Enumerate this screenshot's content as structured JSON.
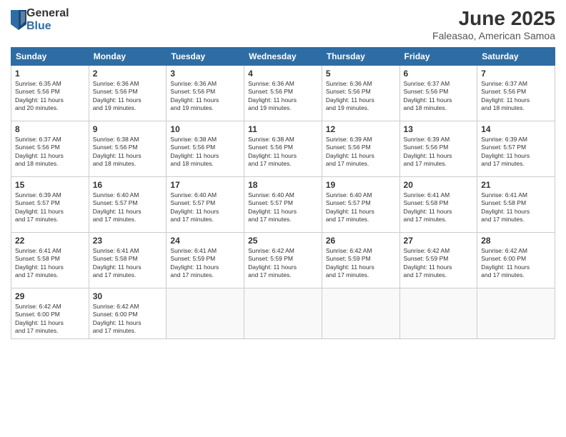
{
  "logo": {
    "general": "General",
    "blue": "Blue"
  },
  "title": "June 2025",
  "location": "Faleasao, American Samoa",
  "headers": [
    "Sunday",
    "Monday",
    "Tuesday",
    "Wednesday",
    "Thursday",
    "Friday",
    "Saturday"
  ],
  "weeks": [
    [
      {
        "day": "1",
        "sunrise": "6:35 AM",
        "sunset": "5:56 PM",
        "daylight": "11 hours and 20 minutes."
      },
      {
        "day": "2",
        "sunrise": "6:36 AM",
        "sunset": "5:56 PM",
        "daylight": "11 hours and 19 minutes."
      },
      {
        "day": "3",
        "sunrise": "6:36 AM",
        "sunset": "5:56 PM",
        "daylight": "11 hours and 19 minutes."
      },
      {
        "day": "4",
        "sunrise": "6:36 AM",
        "sunset": "5:56 PM",
        "daylight": "11 hours and 19 minutes."
      },
      {
        "day": "5",
        "sunrise": "6:36 AM",
        "sunset": "5:56 PM",
        "daylight": "11 hours and 19 minutes."
      },
      {
        "day": "6",
        "sunrise": "6:37 AM",
        "sunset": "5:56 PM",
        "daylight": "11 hours and 18 minutes."
      },
      {
        "day": "7",
        "sunrise": "6:37 AM",
        "sunset": "5:56 PM",
        "daylight": "11 hours and 18 minutes."
      }
    ],
    [
      {
        "day": "8",
        "sunrise": "6:37 AM",
        "sunset": "5:56 PM",
        "daylight": "11 hours and 18 minutes."
      },
      {
        "day": "9",
        "sunrise": "6:38 AM",
        "sunset": "5:56 PM",
        "daylight": "11 hours and 18 minutes."
      },
      {
        "day": "10",
        "sunrise": "6:38 AM",
        "sunset": "5:56 PM",
        "daylight": "11 hours and 18 minutes."
      },
      {
        "day": "11",
        "sunrise": "6:38 AM",
        "sunset": "5:56 PM",
        "daylight": "11 hours and 17 minutes."
      },
      {
        "day": "12",
        "sunrise": "6:39 AM",
        "sunset": "5:56 PM",
        "daylight": "11 hours and 17 minutes."
      },
      {
        "day": "13",
        "sunrise": "6:39 AM",
        "sunset": "5:56 PM",
        "daylight": "11 hours and 17 minutes."
      },
      {
        "day": "14",
        "sunrise": "6:39 AM",
        "sunset": "5:57 PM",
        "daylight": "11 hours and 17 minutes."
      }
    ],
    [
      {
        "day": "15",
        "sunrise": "6:39 AM",
        "sunset": "5:57 PM",
        "daylight": "11 hours and 17 minutes."
      },
      {
        "day": "16",
        "sunrise": "6:40 AM",
        "sunset": "5:57 PM",
        "daylight": "11 hours and 17 minutes."
      },
      {
        "day": "17",
        "sunrise": "6:40 AM",
        "sunset": "5:57 PM",
        "daylight": "11 hours and 17 minutes."
      },
      {
        "day": "18",
        "sunrise": "6:40 AM",
        "sunset": "5:57 PM",
        "daylight": "11 hours and 17 minutes."
      },
      {
        "day": "19",
        "sunrise": "6:40 AM",
        "sunset": "5:57 PM",
        "daylight": "11 hours and 17 minutes."
      },
      {
        "day": "20",
        "sunrise": "6:41 AM",
        "sunset": "5:58 PM",
        "daylight": "11 hours and 17 minutes."
      },
      {
        "day": "21",
        "sunrise": "6:41 AM",
        "sunset": "5:58 PM",
        "daylight": "11 hours and 17 minutes."
      }
    ],
    [
      {
        "day": "22",
        "sunrise": "6:41 AM",
        "sunset": "5:58 PM",
        "daylight": "11 hours and 17 minutes."
      },
      {
        "day": "23",
        "sunrise": "6:41 AM",
        "sunset": "5:58 PM",
        "daylight": "11 hours and 17 minutes."
      },
      {
        "day": "24",
        "sunrise": "6:41 AM",
        "sunset": "5:59 PM",
        "daylight": "11 hours and 17 minutes."
      },
      {
        "day": "25",
        "sunrise": "6:42 AM",
        "sunset": "5:59 PM",
        "daylight": "11 hours and 17 minutes."
      },
      {
        "day": "26",
        "sunrise": "6:42 AM",
        "sunset": "5:59 PM",
        "daylight": "11 hours and 17 minutes."
      },
      {
        "day": "27",
        "sunrise": "6:42 AM",
        "sunset": "5:59 PM",
        "daylight": "11 hours and 17 minutes."
      },
      {
        "day": "28",
        "sunrise": "6:42 AM",
        "sunset": "6:00 PM",
        "daylight": "11 hours and 17 minutes."
      }
    ],
    [
      {
        "day": "29",
        "sunrise": "6:42 AM",
        "sunset": "6:00 PM",
        "daylight": "11 hours and 17 minutes."
      },
      {
        "day": "30",
        "sunrise": "6:42 AM",
        "sunset": "6:00 PM",
        "daylight": "11 hours and 17 minutes."
      },
      null,
      null,
      null,
      null,
      null
    ]
  ],
  "labels": {
    "sunrise": "Sunrise:",
    "sunset": "Sunset:",
    "daylight": "Daylight: 11 hours"
  }
}
